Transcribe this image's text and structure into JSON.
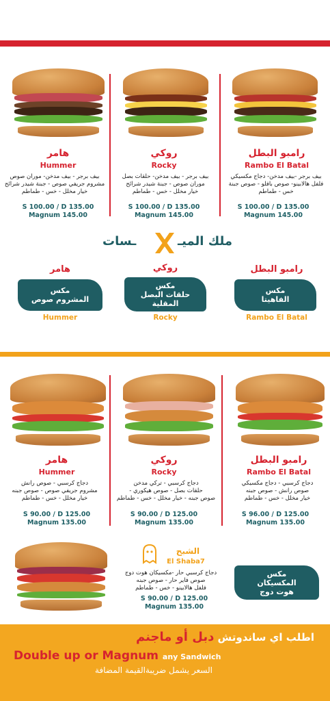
{
  "colors": {
    "red": "#d6232f",
    "teal": "#1f5d63",
    "orange": "#f2a21b"
  },
  "top": {
    "items": [
      {
        "ar": "رامبو البطل",
        "en": "Rambo El Batal",
        "desc": [
          "بيف برجر -بيف مدخن- دجاج مكسيكي",
          "فلفل هالابينو- صوص بافلو - صوص جبنة",
          "خس - طماطم"
        ],
        "price": "S 100.00 / D 135.00",
        "magnum": "Magnum 145.00"
      },
      {
        "ar": "روكي",
        "en": "Rocky",
        "desc": [
          "بيف برجر - بيف مدخن- حلقات بصل",
          "موران صوص - جبنة شيدر شرائح",
          "خيار مخلل - خس - طماطم"
        ],
        "price": "S 100.00 / D 135.00",
        "magnum": "Magnum 145.00"
      },
      {
        "ar": "هامر",
        "en": "Hummer",
        "desc": [
          "بيف برجر - بيف مدخن- موران صوص",
          "مشروم جريفي صوص - جبنة شيدر شرائح",
          "خيار مخلل - خس - طماطم"
        ],
        "price": "S 100.00 / D 135.00",
        "magnum": "Magnum 145.00"
      }
    ]
  },
  "king_title": {
    "left": "ملك الميـ",
    "right": "ـسات"
  },
  "mix": [
    {
      "ar": "رامبو البطل",
      "label": [
        "مكس",
        "الفاهيتا"
      ],
      "en": "Rambo El Batal"
    },
    {
      "ar": "روكي",
      "label": [
        "مكس",
        "حلقات البصل",
        "المقلية"
      ],
      "en": "Rocky"
    },
    {
      "ar": "هامر",
      "label": [
        "مكس",
        "المشروم صوص"
      ],
      "en": "Hummer"
    }
  ],
  "bottom_items": [
    {
      "ar": "رامبو البطل",
      "en": "Rambo El Batal",
      "desc": [
        "دجاج كرسبي - دجاج مكسيكي",
        "صوص رانش - صوص جبنه",
        "خيار مخلل - خس - طماطم"
      ],
      "price": "S 96.00 / D 125.00",
      "magnum": "Magnum 135.00"
    },
    {
      "ar": "روكي",
      "en": "Rocky",
      "desc": [
        "دجاج كرسبي - تركي مدخن",
        "حلقات بصل - صوص هيكوري -",
        "صوص جبنه - خيار مخلل - خس - طماطم"
      ],
      "price": "S 90.00 / D 125.00",
      "magnum": "Magnum 135.00"
    },
    {
      "ar": "هامر",
      "en": "Hummer",
      "desc": [
        "دجاج كرسبي - صوص رانش",
        "مشروم جريفي صوص - صوص جبنه",
        "خيار مخلل - خس - طماطم"
      ],
      "price": "S 90.00 / D 125.00",
      "magnum": "Magnum 135.00"
    }
  ],
  "shaba7": {
    "ar": "الشبح",
    "en": "El Shaba7",
    "desc": [
      "دجاج كرسبي حار -مكسيكان هوت دوج",
      "صوص فاير حار - صوص جبنه",
      "فلفل هالابينو - خس - طماطم"
    ],
    "price": "S 90.00 / D 125.00",
    "magnum": "Magnum 135.00",
    "mix": [
      "مكس",
      "المكسيكان",
      "هوت دوج"
    ]
  },
  "banner": {
    "ar_pre": "اطلب اي ساندوتش",
    "ar_red": "دبل أو ماجنم",
    "en": "Double up or Magnum",
    "en_small": "any Sandwich",
    "vat": "السعر يشمل ضريبةالقيمة المضافة"
  }
}
